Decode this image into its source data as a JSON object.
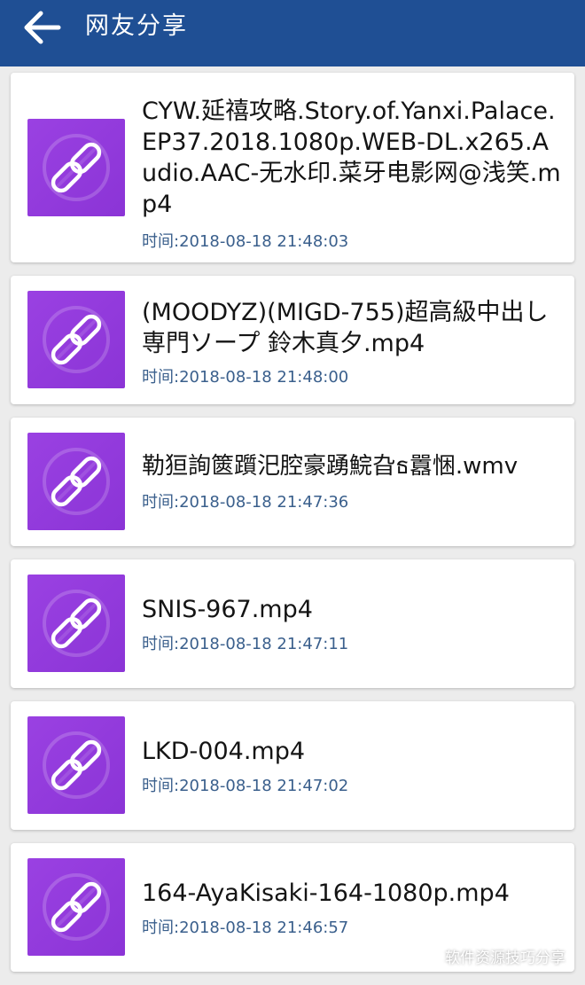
{
  "appbar": {
    "title": "网友分享",
    "back_icon": "arrow-left-icon",
    "background_color": "#1f4f94"
  },
  "items": [
    {
      "name": "CYW.延禧攻略.Story.of.Yanxi.Palace.EP37.2018.1080p.WEB-DL.x265.Audio.AAC-无水印.菜牙电影网@浅笑.mp4",
      "time": "时间:2018-08-18 21:48:03",
      "icon": "link-icon"
    },
    {
      "name": "(MOODYZ)(MIGD-755)超高級中出し専門ソープ 鈴木真夕.mp4",
      "time": "时间:2018-08-18 21:48:00",
      "icon": "link-icon"
    },
    {
      "name": "勒狟詢篋躓汜腔豪踴鯇旮ธ囂悃.wmv",
      "time": "时间:2018-08-18 21:47:36",
      "icon": "link-icon"
    },
    {
      "name": "SNIS-967.mp4",
      "time": "时间:2018-08-18 21:47:11",
      "icon": "link-icon"
    },
    {
      "name": "LKD-004.mp4",
      "time": "时间:2018-08-18 21:47:02",
      "icon": "link-icon"
    },
    {
      "name": "164-AyaKisaki-164-1080p.mp4",
      "time": "时间:2018-08-18 21:46:57",
      "icon": "link-icon"
    }
  ],
  "watermark": {
    "text": "软件资源技巧分享",
    "icon": "wechat-icon"
  },
  "colors": {
    "thumb": "#9a41e2",
    "time_text": "#3a5f8c"
  }
}
